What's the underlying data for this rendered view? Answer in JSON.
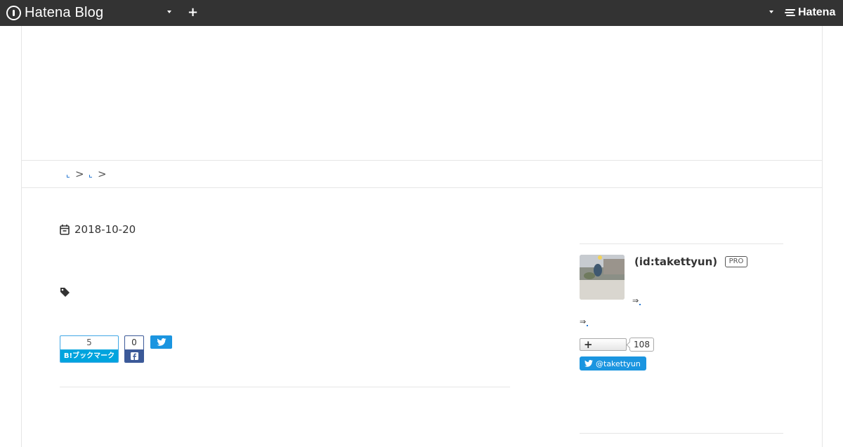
{
  "topbar": {
    "logo_text": "Hatena Blog",
    "brand_text": "Hatena",
    "icons": [
      "hatena-blog-logo-icon",
      "caret-down-icon",
      "plus-icon",
      "hatena-logo-icon"
    ],
    "background": "#333333"
  },
  "breadcrumb": {
    "separators": [
      ">",
      ">"
    ]
  },
  "article": {
    "date": "2018-10-20",
    "share": {
      "hatena_count": "5",
      "hatena_label": "B!ブックマーク",
      "facebook_count": "0"
    }
  },
  "sidebar": {
    "profile_id": "(id:takettyun)",
    "pro_badge": "PRO",
    "arrow_1": "⇒",
    "arrow_2": "⇒",
    "follower_count": "108",
    "twitter_handle": "@takettyun"
  },
  "colors": {
    "hatena_blue": "#00a4de",
    "facebook_blue": "#3b5998",
    "twitter_blue": "#1b95e0",
    "link_blue": "#2a7ad2"
  }
}
